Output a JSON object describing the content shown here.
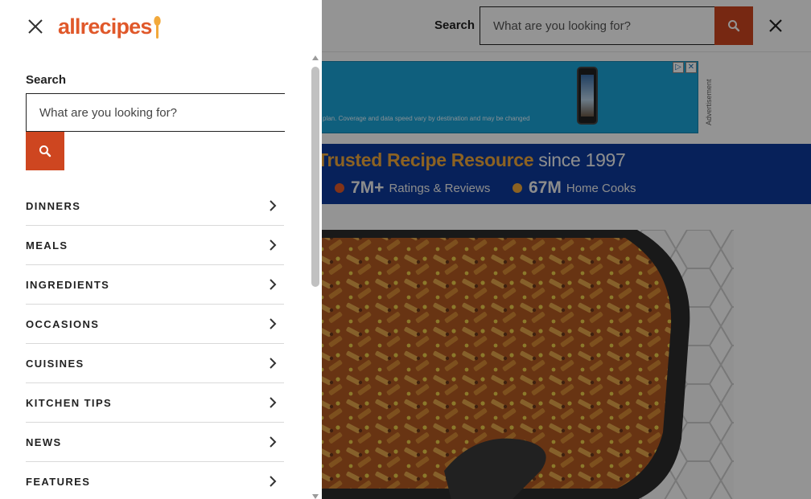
{
  "drawer": {
    "logo_text": "allrecipes",
    "search_label": "Search",
    "search_placeholder": "What are you looking for?",
    "nav_items": [
      {
        "label": "DINNERS"
      },
      {
        "label": "MEALS"
      },
      {
        "label": "INGREDIENTS"
      },
      {
        "label": "OCCASIONS"
      },
      {
        "label": "CUISINES"
      },
      {
        "label": "KITCHEN TIPS"
      },
      {
        "label": "NEWS"
      },
      {
        "label": "FEATURES"
      }
    ]
  },
  "header": {
    "search_label": "Search",
    "search_placeholder": "What are you looking for?"
  },
  "ad": {
    "text": "plan. Coverage and data speed vary by destination and may be changed",
    "label": "Advertisement",
    "choices_icon": "ad-choices-icon",
    "close_icon": "ad-close-icon"
  },
  "trust_band": {
    "headline_highlight": "Trusted Recipe Resource",
    "headline_rest": " since 1997",
    "stats": [
      {
        "number": "7M+",
        "label": "Ratings & Reviews",
        "dot_color": "#e0582a"
      },
      {
        "number": "67M",
        "label": "Home Cooks",
        "dot_color": "#f2a93b"
      }
    ]
  },
  "hero": {
    "image_description_icon": "pasta-bake-image"
  },
  "colors": {
    "brand_orange": "#e0582a",
    "search_button": "#ce4620",
    "trust_band_blue": "#0d3a9b",
    "highlight_gold": "#f2a93b"
  }
}
